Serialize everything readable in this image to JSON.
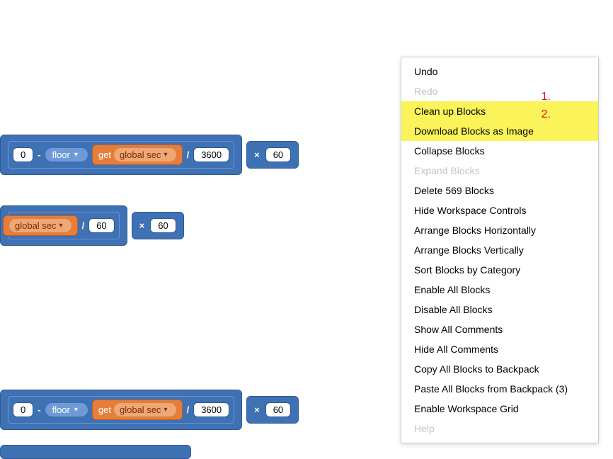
{
  "blocks": {
    "row1": {
      "leading_num": "0",
      "minus": "-",
      "floor_label": "floor",
      "get_label": "get",
      "var_label": "global sec",
      "div": "/",
      "divisor": "3600",
      "times": "×",
      "mult_val": "60"
    },
    "row2": {
      "var_label": "global sec",
      "div": "/",
      "divisor": "60",
      "times": "×",
      "mult_val": "60"
    },
    "row3": {
      "leading_num": "0",
      "minus": "-",
      "floor_label": "floor",
      "get_label": "get",
      "var_label": "global sec",
      "div": "/",
      "divisor": "3600",
      "times": "×",
      "mult_val": "60"
    }
  },
  "context_menu": {
    "items": [
      {
        "label": "Undo",
        "enabled": true,
        "highlight": false
      },
      {
        "label": "Redo",
        "enabled": false,
        "highlight": false
      },
      {
        "label": "Clean up Blocks",
        "enabled": true,
        "highlight": true
      },
      {
        "label": "Download Blocks as Image",
        "enabled": true,
        "highlight": true
      },
      {
        "label": "Collapse Blocks",
        "enabled": true,
        "highlight": false
      },
      {
        "label": "Expand Blocks",
        "enabled": false,
        "highlight": false
      },
      {
        "label": "Delete 569 Blocks",
        "enabled": true,
        "highlight": false
      },
      {
        "label": "Hide Workspace Controls",
        "enabled": true,
        "highlight": false
      },
      {
        "label": "Arrange Blocks Horizontally",
        "enabled": true,
        "highlight": false
      },
      {
        "label": "Arrange Blocks Vertically",
        "enabled": true,
        "highlight": false
      },
      {
        "label": "Sort Blocks by Category",
        "enabled": true,
        "highlight": false
      },
      {
        "label": "Enable All Blocks",
        "enabled": true,
        "highlight": false
      },
      {
        "label": "Disable All Blocks",
        "enabled": true,
        "highlight": false
      },
      {
        "label": "Show All Comments",
        "enabled": true,
        "highlight": false
      },
      {
        "label": "Hide All Comments",
        "enabled": true,
        "highlight": false
      },
      {
        "label": "Copy All Blocks to Backpack",
        "enabled": true,
        "highlight": false
      },
      {
        "label": "Paste All Blocks from Backpack (3)",
        "enabled": true,
        "highlight": false
      },
      {
        "label": "Enable Workspace Grid",
        "enabled": true,
        "highlight": false
      },
      {
        "label": "Help",
        "enabled": false,
        "highlight": false
      }
    ]
  },
  "annotations": {
    "one": "1.",
    "two": "2."
  }
}
